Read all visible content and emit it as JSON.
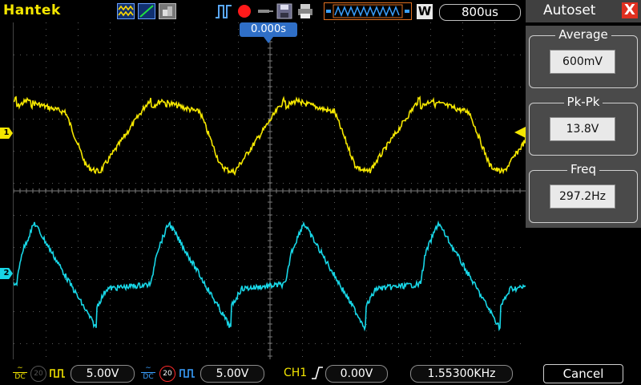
{
  "app": {
    "brand": "Hantek"
  },
  "topbar": {
    "timebase": "800us",
    "trigger_mode_letter": "W",
    "trigger_position": "0.000s",
    "icons": [
      "acquire-mode-icon",
      "line-mode-icon",
      "persistence-icon",
      "trigger-icon",
      "record-icon",
      "probe-icon",
      "save-icon",
      "print-icon",
      "memory-waveform-icon"
    ]
  },
  "screen": {
    "ch1_marker": "1",
    "ch2_marker": "2",
    "ch1_color": "#f4e600",
    "ch2_color": "#18d6e6",
    "grid_color": "#5a5a5a"
  },
  "panel": {
    "title": "Autoset",
    "close_symbol": "X",
    "measurements": [
      {
        "label": "Average",
        "value": "600mV"
      },
      {
        "label": "Pk-Pk",
        "value": "13.8V"
      },
      {
        "label": "Freq",
        "value": "297.2Hz"
      }
    ],
    "cancel_label": "Cancel"
  },
  "bottombar": {
    "ch1": {
      "coupling": "DC",
      "bw_limit": "20",
      "volts": "5.00V"
    },
    "ch2": {
      "coupling": "DC",
      "bw_limit": "20",
      "volts": "5.00V"
    },
    "trigger": {
      "source": "CH1",
      "level": "0.00V",
      "frequency": "1.55300KHz"
    }
  }
}
